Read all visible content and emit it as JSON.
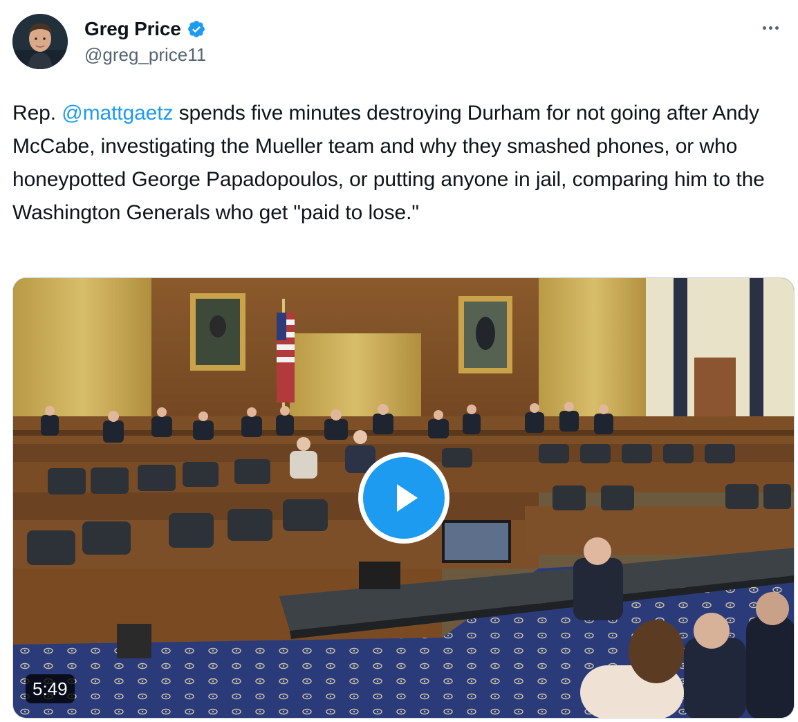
{
  "author": {
    "display_name": "Greg Price",
    "handle": "@greg_price11",
    "verified": true,
    "avatar_icon": "avatar-photo"
  },
  "more_icon": "more-horizontal-icon",
  "tweet": {
    "text_before_mention": "Rep. ",
    "mention": "@mattgaetz",
    "text_after_mention": " spends five minutes destroying Durham for not going after Andy McCabe, investigating the Mueller team and why they smashed phones, or who honeypotted George Papadopoulos, or putting anyone in jail, comparing him to the Washington Generals who get \"paid to lose.\""
  },
  "media": {
    "type": "video",
    "duration": "5:49",
    "play_icon": "play-icon"
  },
  "colors": {
    "accent": "#1d9bf0",
    "text_primary": "#0f1419",
    "text_secondary": "#536471"
  }
}
